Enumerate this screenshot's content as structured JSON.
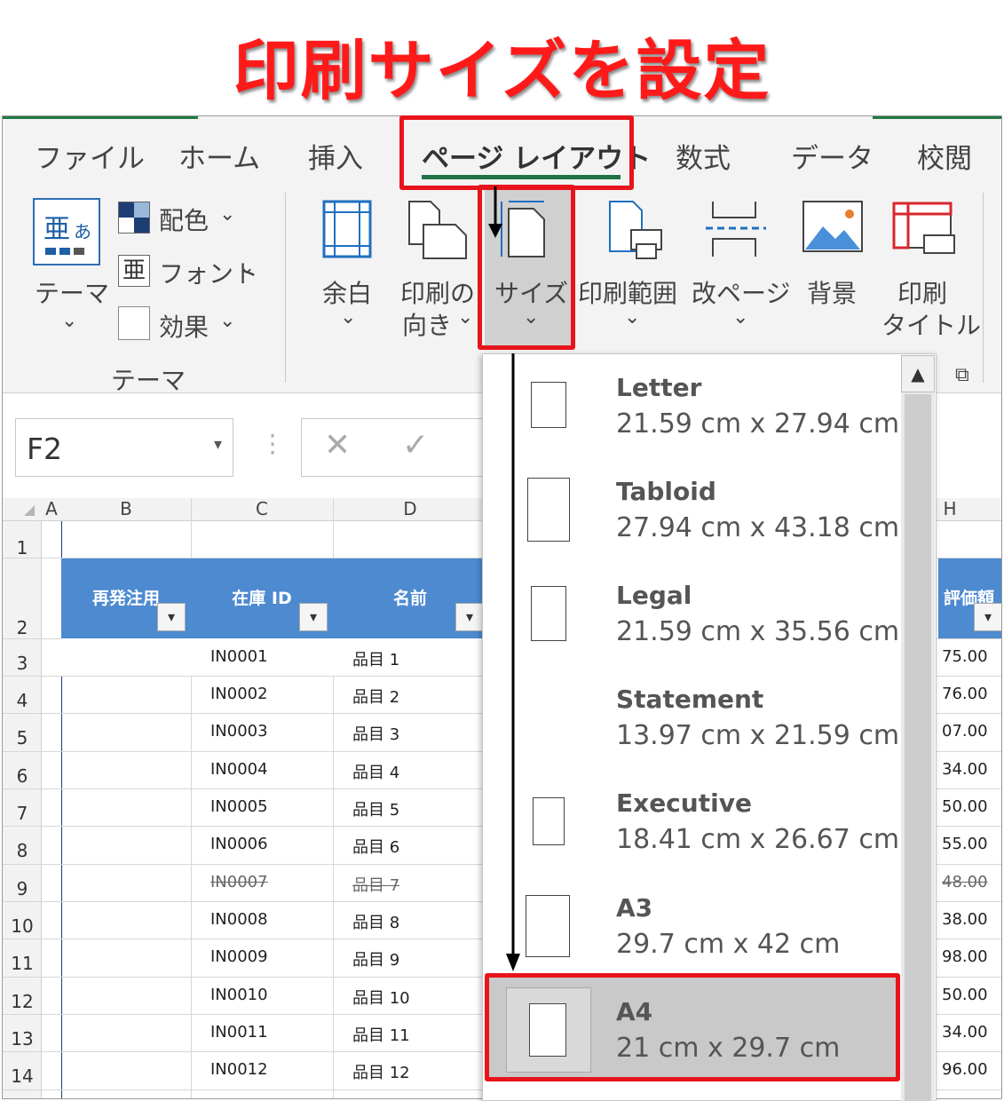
{
  "title": "印刷サイズを設定",
  "ribbon": {
    "tabs": [
      {
        "label": "ファイル"
      },
      {
        "label": "ホーム"
      },
      {
        "label": "挿入"
      },
      {
        "label": "ページ レイアウト"
      },
      {
        "label": "数式"
      },
      {
        "label": "データ"
      },
      {
        "label": "校閲"
      }
    ],
    "active_tab": "ページ レイアウト",
    "theme_group": {
      "themes_label": "テーマ",
      "colors_label": "配色",
      "fonts_label": "フォント",
      "effects_label": "効果",
      "group_label": "テーマ"
    },
    "page_setup": {
      "margins": "余白",
      "orientation_line1": "印刷の",
      "orientation_line2": "向き",
      "size": "サイズ",
      "print_area": "印刷範囲",
      "breaks": "改ページ",
      "background": "背景",
      "print_titles_line1": "印刷",
      "print_titles_line2": "タイトル"
    }
  },
  "formula_bar": {
    "name_box": "F2"
  },
  "grid": {
    "columns": [
      "A",
      "B",
      "C",
      "D",
      "H"
    ],
    "headers": [
      "再発注用",
      "在庫 ID",
      "名前",
      "評価額"
    ],
    "rows": [
      {
        "num": "1",
        "id": "",
        "name": "",
        "value": ""
      },
      {
        "num": "2",
        "id": "",
        "name": "",
        "value": ""
      },
      {
        "num": "3",
        "id": "IN0001",
        "name": "品目 1",
        "value": "75.00"
      },
      {
        "num": "4",
        "id": "IN0002",
        "name": "品目 2",
        "value": "76.00"
      },
      {
        "num": "5",
        "id": "IN0003",
        "name": "品目 3",
        "value": "07.00"
      },
      {
        "num": "6",
        "id": "IN0004",
        "name": "品目 4",
        "value": "34.00"
      },
      {
        "num": "7",
        "id": "IN0005",
        "name": "品目 5",
        "value": "50.00"
      },
      {
        "num": "8",
        "id": "IN0006",
        "name": "品目 6",
        "value": "55.00"
      },
      {
        "num": "9",
        "id": "IN0007",
        "name": "品目 7",
        "value": "48.00"
      },
      {
        "num": "10",
        "id": "IN0008",
        "name": "品目 8",
        "value": "38.00"
      },
      {
        "num": "11",
        "id": "IN0009",
        "name": "品目 9",
        "value": "98.00"
      },
      {
        "num": "12",
        "id": "IN0010",
        "name": "品目 10",
        "value": "50.00"
      },
      {
        "num": "13",
        "id": "IN0011",
        "name": "品目 11",
        "value": "34.00"
      },
      {
        "num": "14",
        "id": "IN0012",
        "name": "品目 12",
        "value": "96.00"
      }
    ]
  },
  "size_dropdown": {
    "items": [
      {
        "name": "Letter",
        "size": "21.59 cm x 27.94 cm"
      },
      {
        "name": "Tabloid",
        "size": "27.94 cm x 43.18 cm"
      },
      {
        "name": "Legal",
        "size": "21.59 cm x 35.56 cm"
      },
      {
        "name": "Statement",
        "size": "13.97 cm x 21.59 cm"
      },
      {
        "name": "Executive",
        "size": "18.41 cm x 26.67 cm"
      },
      {
        "name": "A3",
        "size": "29.7 cm x 42 cm"
      },
      {
        "name": "A4",
        "size": "21 cm x 29.7 cm"
      }
    ],
    "selected": "A4"
  },
  "colors": {
    "title_red": "#ff1a1a",
    "highlight_red": "#e8141b",
    "excel_green": "#217346",
    "table_header_blue": "#4d8ad0",
    "selected_gray": "#c9c9c9"
  }
}
